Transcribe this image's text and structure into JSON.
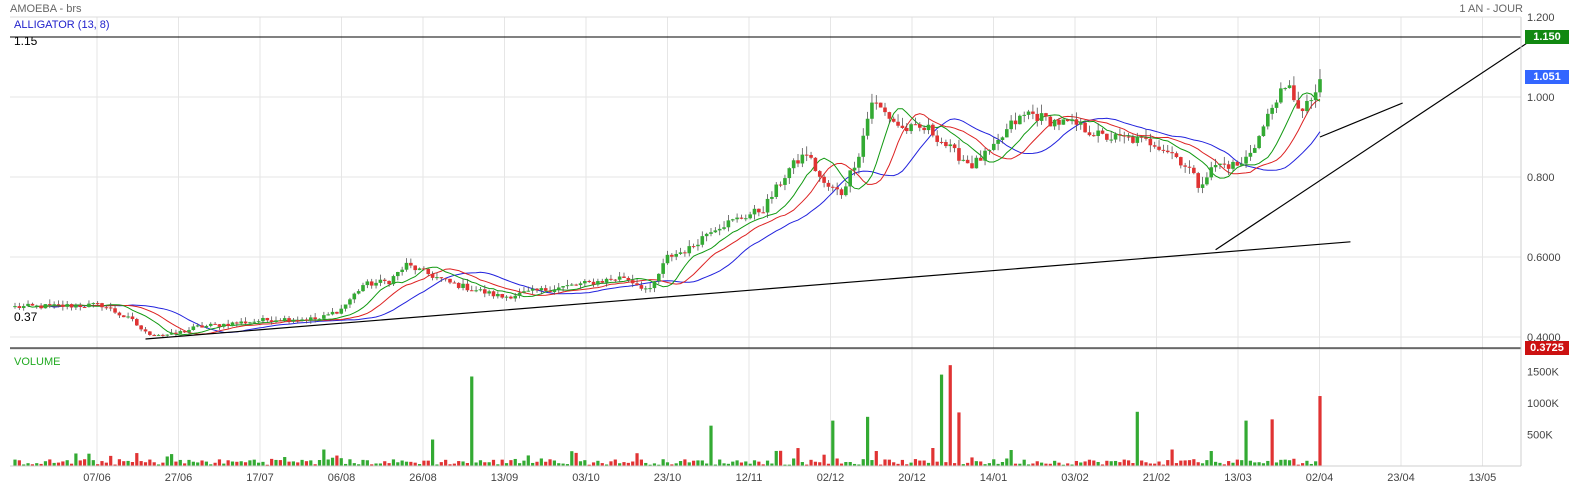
{
  "header": {
    "title": "AMOEBA - brs",
    "period": "1 AN - JOUR",
    "indicator": "ALLIGATOR (13, 8)",
    "volume_label": "VOLUME"
  },
  "levels": [
    {
      "label": "1.15",
      "value": 1.15
    },
    {
      "label": "0.37",
      "value": 0.3725
    }
  ],
  "price_tags": [
    {
      "text": "1.150",
      "value": 1.15,
      "color": "#118811"
    },
    {
      "text": "1.051",
      "value": 1.051,
      "color": "#3366ff"
    },
    {
      "text": "0.3725",
      "value": 0.3725,
      "color": "#cc1111"
    }
  ],
  "colors": {
    "up": "#33aa33",
    "down": "#e03333",
    "jaw": "#2222dd",
    "teeth": "#dd2222",
    "lips": "#119911",
    "grid": "#e6e6e6",
    "trend": "#000000"
  },
  "chart_data": {
    "type": "candlestick",
    "y_axis": {
      "min": 0.37,
      "max": 1.2,
      "ticks": [
        "1.200",
        "1.000",
        "0.800",
        "0.6000",
        "0.4000"
      ],
      "tick_values": [
        1.2,
        1.0,
        0.8,
        0.6,
        0.4
      ]
    },
    "volume_axis": {
      "ticks": [
        "1500K",
        "1000K",
        "500K"
      ],
      "tick_values": [
        1500,
        1000,
        500
      ]
    },
    "x_axis": {
      "ticks": [
        "07/06",
        "27/06",
        "17/07",
        "06/08",
        "26/08",
        "13/09",
        "03/10",
        "23/10",
        "12/11",
        "02/12",
        "20/12",
        "14/01",
        "03/02",
        "21/02",
        "13/03",
        "02/04",
        "23/04",
        "13/05"
      ]
    },
    "price_path": [
      [
        0,
        0.475
      ],
      [
        20,
        0.48
      ],
      [
        27,
        0.44
      ],
      [
        30,
        0.41
      ],
      [
        36,
        0.405
      ],
      [
        42,
        0.425
      ],
      [
        60,
        0.445
      ],
      [
        70,
        0.445
      ],
      [
        75,
        0.47
      ],
      [
        80,
        0.53
      ],
      [
        86,
        0.54
      ],
      [
        90,
        0.58
      ],
      [
        100,
        0.535
      ],
      [
        112,
        0.5
      ],
      [
        120,
        0.515
      ],
      [
        132,
        0.535
      ],
      [
        140,
        0.55
      ],
      [
        146,
        0.515
      ],
      [
        150,
        0.6
      ],
      [
        155,
        0.62
      ],
      [
        160,
        0.67
      ],
      [
        165,
        0.69
      ],
      [
        172,
        0.72
      ],
      [
        178,
        0.82
      ],
      [
        182,
        0.86
      ],
      [
        186,
        0.78
      ],
      [
        190,
        0.76
      ],
      [
        194,
        0.86
      ],
      [
        197,
        0.99
      ],
      [
        200,
        0.96
      ],
      [
        204,
        0.92
      ],
      [
        210,
        0.92
      ],
      [
        216,
        0.86
      ],
      [
        220,
        0.83
      ],
      [
        225,
        0.87
      ],
      [
        229,
        0.93
      ],
      [
        233,
        0.96
      ],
      [
        238,
        0.94
      ],
      [
        244,
        0.93
      ],
      [
        250,
        0.9
      ],
      [
        256,
        0.895
      ],
      [
        262,
        0.885
      ],
      [
        266,
        0.86
      ],
      [
        270,
        0.82
      ],
      [
        272,
        0.78
      ],
      [
        276,
        0.83
      ],
      [
        282,
        0.83
      ],
      [
        286,
        0.9
      ],
      [
        290,
        1.0
      ],
      [
        293,
        1.02
      ],
      [
        296,
        0.96
      ],
      [
        300,
        1.03
      ]
    ],
    "volume_series": [
      {
        "day": 105,
        "volume": 1420,
        "up": true
      },
      {
        "day": 215,
        "volume": 1600,
        "up": false
      },
      {
        "day": 213,
        "volume": 1450,
        "up": true
      },
      {
        "day": 217,
        "volume": 850,
        "up": false
      },
      {
        "day": 258,
        "volume": 860,
        "up": true
      },
      {
        "day": 300,
        "volume": 1110,
        "up": false
      },
      {
        "day": 289,
        "volume": 740,
        "up": false
      },
      {
        "day": 283,
        "volume": 720,
        "up": true
      },
      {
        "day": 160,
        "volume": 640,
        "up": true
      },
      {
        "day": 196,
        "volume": 780,
        "up": true
      },
      {
        "day": 188,
        "volume": 720,
        "up": true
      },
      {
        "day": 96,
        "volume": 420,
        "up": true
      }
    ],
    "trendlines": [
      {
        "from": [
          30,
          0.395
        ],
        "to": [
          307,
          0.638
        ]
      },
      {
        "from": [
          276,
          0.618
        ],
        "to": [
          349,
          1.145
        ]
      },
      {
        "from": [
          300,
          0.9
        ],
        "to": [
          319,
          0.985
        ]
      }
    ],
    "horizontal_lines": [
      1.15,
      0.3725
    ]
  }
}
